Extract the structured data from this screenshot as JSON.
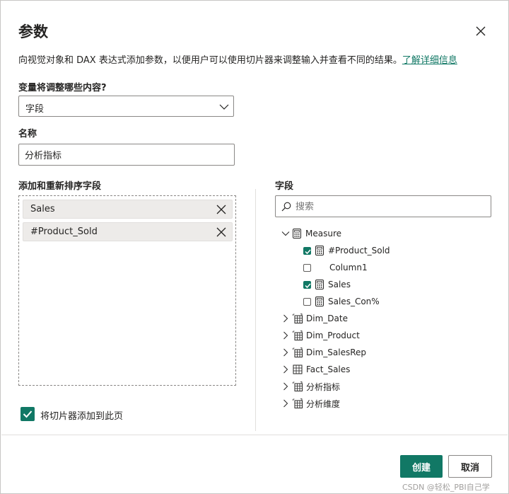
{
  "dialog": {
    "title": "参数",
    "description": "向视觉对象和 DAX 表达式添加参数，以便用户可以使用切片器来调整输入并查看不同的结果。",
    "learn_more": "了解详细信息"
  },
  "variable": {
    "label": "变量将调整哪些内容?",
    "selected": "字段"
  },
  "name": {
    "label": "名称",
    "value": "分析指标"
  },
  "reorder": {
    "label": "添加和重新排序字段",
    "items": [
      {
        "label": "Sales"
      },
      {
        "label": "#Product_Sold"
      }
    ]
  },
  "fields": {
    "label": "字段",
    "search_placeholder": "搜索",
    "measure_table": "Measure",
    "measure_items": [
      {
        "label": "#Product_Sold",
        "checked": true,
        "icon": "calculator-icon"
      },
      {
        "label": "Column1",
        "checked": false,
        "icon": ""
      },
      {
        "label": "Sales",
        "checked": true,
        "icon": "calculator-icon"
      },
      {
        "label": "Sales_Con%",
        "checked": false,
        "icon": "calculator-icon"
      }
    ],
    "tables": [
      {
        "label": "Dim_Date",
        "icon": "param-table-icon"
      },
      {
        "label": "Dim_Product",
        "icon": "param-table-icon"
      },
      {
        "label": "Dim_SalesRep",
        "icon": "param-table-icon"
      },
      {
        "label": "Fact_Sales",
        "icon": "table-icon"
      },
      {
        "label": "分析指标",
        "icon": "param-table-icon"
      },
      {
        "label": "分析维度",
        "icon": "param-table-icon"
      }
    ]
  },
  "footer": {
    "add_slicer": "将切片器添加到此页",
    "add_slicer_checked": true,
    "create": "创建",
    "cancel": "取消"
  },
  "watermark": "CSDN @轻松_PBI自己学",
  "colors": {
    "accent": "#117865",
    "border": "#8a8886",
    "chip_bg": "#edebe9"
  }
}
